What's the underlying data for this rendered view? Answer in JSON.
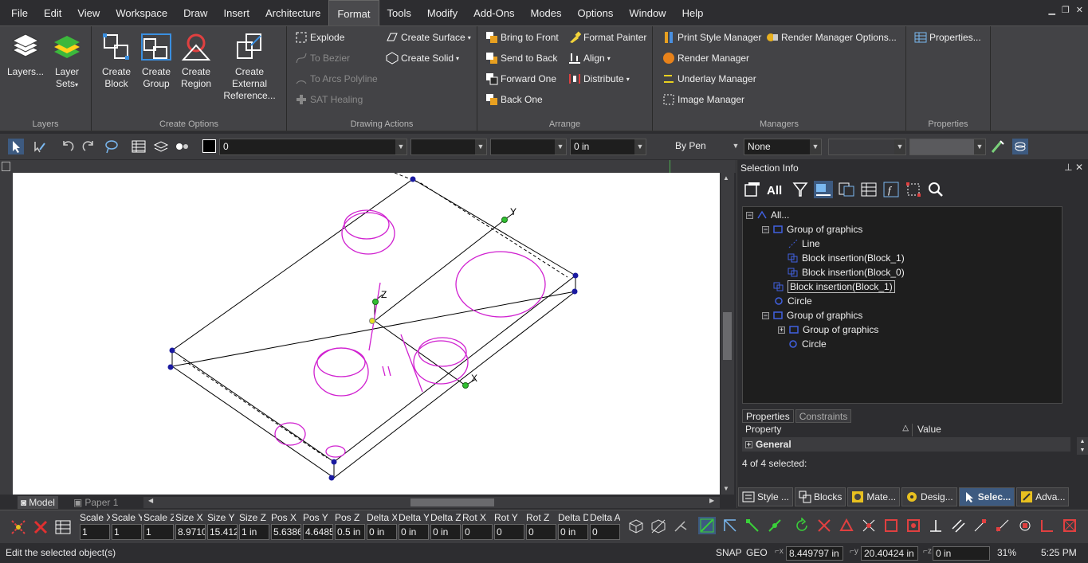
{
  "menu": [
    "File",
    "Edit",
    "View",
    "Workspace",
    "Draw",
    "Insert",
    "Architecture",
    "Format",
    "Tools",
    "Modify",
    "Add-Ons",
    "Modes",
    "Options",
    "Window",
    "Help"
  ],
  "ribbon": {
    "layers": {
      "label": "Layers",
      "layers_btn": "Layers...",
      "layer_sets": "Layer Sets"
    },
    "create_options": {
      "label": "Create Options",
      "block": "Create Block",
      "group": "Create Group",
      "region": "Create Region",
      "xref": "Create External Reference..."
    },
    "drawing_actions": {
      "label": "Drawing Actions",
      "explode": "Explode",
      "to_bezier": "To Bezier",
      "to_arcs": "To Arcs Polyline",
      "sat_healing": "SAT Healing",
      "create_surface": "Create Surface",
      "create_solid": "Create Solid"
    },
    "arrange": {
      "label": "Arrange",
      "bring_front": "Bring to Front",
      "send_back": "Send to Back",
      "forward_one": "Forward One",
      "back_one": "Back One",
      "format_painter": "Format Painter",
      "align": "Align",
      "distribute": "Distribute"
    },
    "managers": {
      "label": "Managers",
      "print_style": "Print Style Manager",
      "render_options": "Render Manager Options...",
      "render": "Render Manager",
      "underlay": "Underlay Manager",
      "image": "Image Manager"
    },
    "properties": {
      "label": "Properties",
      "btn": "Properties..."
    }
  },
  "toolbar": {
    "layer": "0",
    "thickness": "0 in",
    "pen": "By Pen",
    "line_style": "None"
  },
  "canvas": {
    "axis_y": "Y",
    "axis_z": "Z",
    "axis_x": "X",
    "tab_model": "Model",
    "tab_paper": "Paper 1"
  },
  "panel": {
    "title": "Selection Info",
    "tree": [
      "All...",
      "Group of graphics",
      "Line",
      "Block insertion(Block_1)",
      "Block insertion(Block_0)",
      "Block insertion(Block_1)",
      "Circle",
      "Group of graphics",
      "Group of graphics",
      "Circle"
    ],
    "tabs": [
      "Properties",
      "Constraints"
    ],
    "col_property": "Property",
    "col_value": "Value",
    "general": "General",
    "selected": "4 of 4 selected:"
  },
  "bottom_tabs": [
    "Style ...",
    "Blocks",
    "Mate...",
    "Desig...",
    "Selec...",
    "Adva..."
  ],
  "fields": [
    {
      "label": "Scale X",
      "value": "1"
    },
    {
      "label": "Scale Y",
      "value": "1"
    },
    {
      "label": "Scale Z",
      "value": "1"
    },
    {
      "label": "Size X",
      "value": "8.9710"
    },
    {
      "label": "Size Y",
      "value": "15.412"
    },
    {
      "label": "Size Z",
      "value": "1 in"
    },
    {
      "label": "Pos X",
      "value": "5.6386"
    },
    {
      "label": "Pos Y",
      "value": "4.6485"
    },
    {
      "label": "Pos Z",
      "value": "0.5 in"
    },
    {
      "label": "Delta X",
      "value": "0 in"
    },
    {
      "label": "Delta Y",
      "value": "0 in"
    },
    {
      "label": "Delta Z",
      "value": "0 in"
    },
    {
      "label": "Rot X",
      "value": "0"
    },
    {
      "label": "Rot Y",
      "value": "0"
    },
    {
      "label": "Rot Z",
      "value": "0"
    },
    {
      "label": "Delta D",
      "value": "0 in"
    },
    {
      "label": "Delta A",
      "value": "0"
    }
  ],
  "status": {
    "message": "Edit the selected object(s)",
    "snap": "SNAP",
    "geo": "GEO",
    "x": "8.449797 in",
    "y": "20.40424 in",
    "z": "0 in",
    "zoom": "31%",
    "time": "5:25 PM"
  },
  "colors": {
    "magenta": "#d020d0",
    "accent": "#3d5a80",
    "ribbon": "#434346"
  }
}
